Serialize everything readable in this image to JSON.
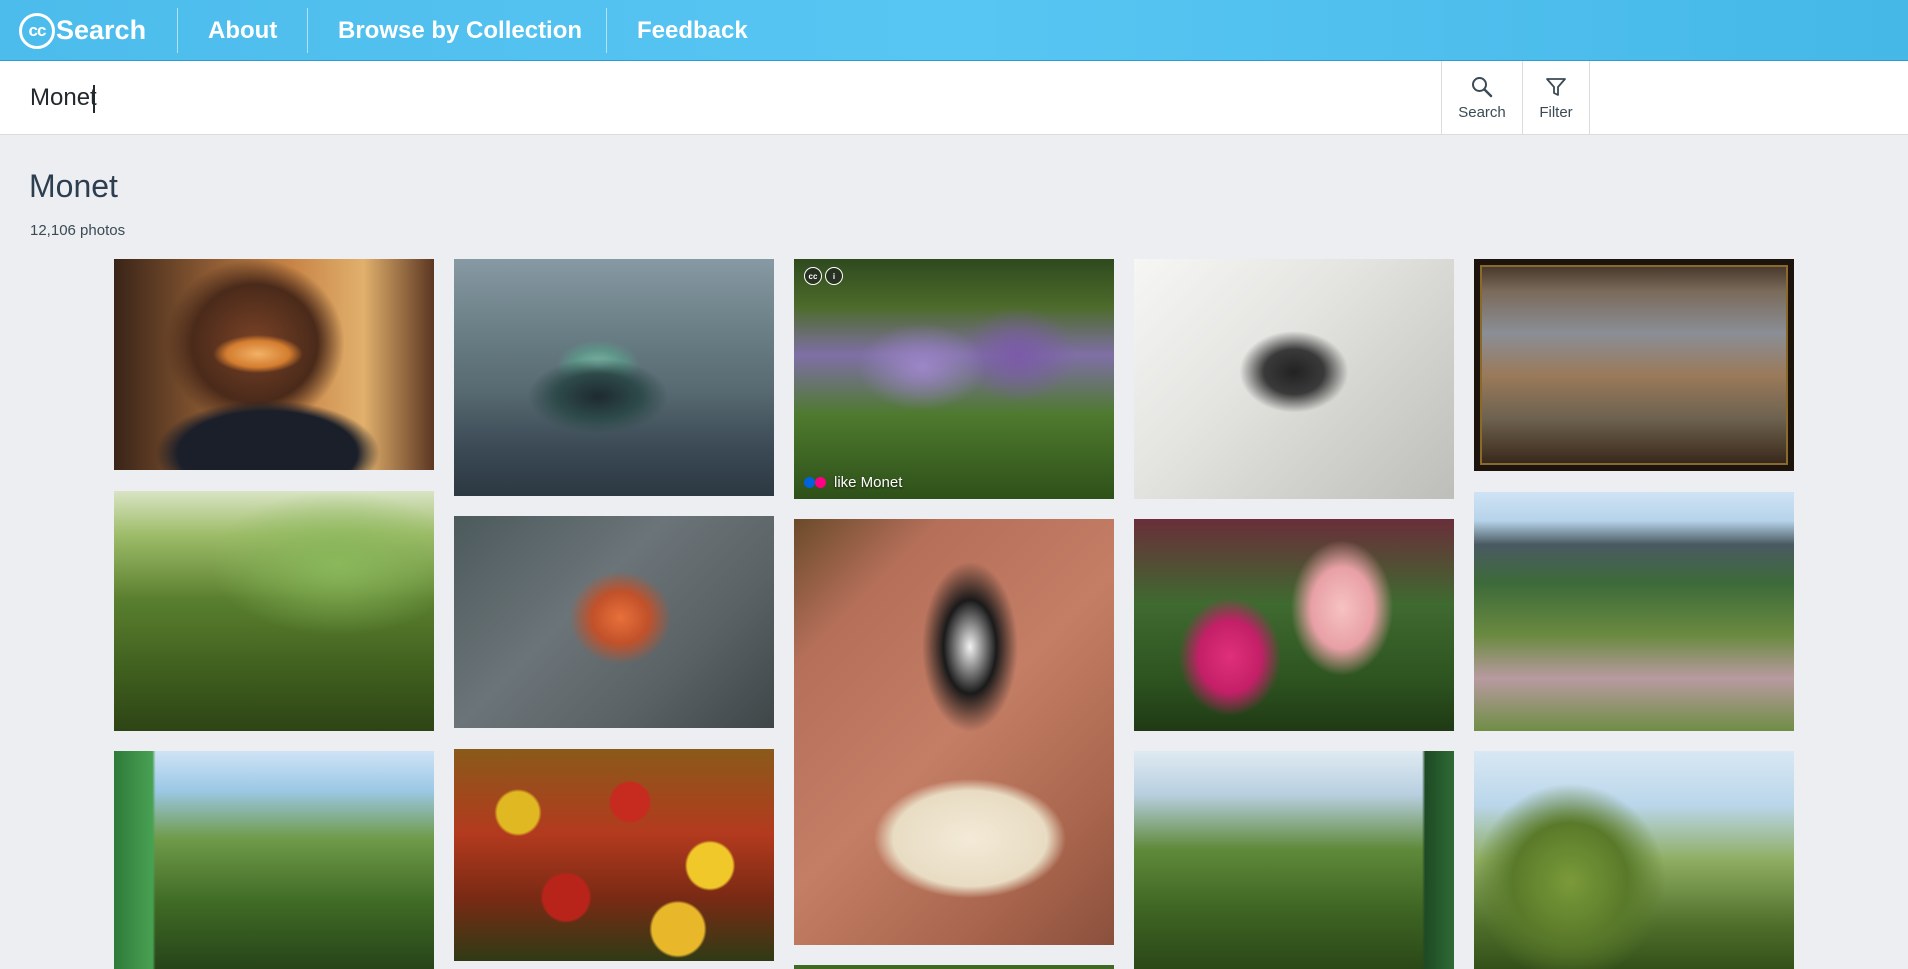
{
  "header": {
    "logo_cc": "cc",
    "logo_text": "Search",
    "nav": [
      "About",
      "Browse by Collection",
      "Feedback"
    ]
  },
  "search": {
    "value": "Monet",
    "buttons": {
      "search": "Search",
      "filter": "Filter"
    }
  },
  "results": {
    "title": "Monet",
    "count": "12,106 photos"
  },
  "tiles": {
    "t3": {
      "caption": "like Monet",
      "license_icons": [
        "cc-icon",
        "by-icon"
      ]
    }
  },
  "colors": {
    "header_start": "#4cbcec",
    "header_end": "#45b8e8",
    "page_bg": "#eceef1",
    "flickr_blue": "#0063dc",
    "flickr_pink": "#ff0084"
  }
}
